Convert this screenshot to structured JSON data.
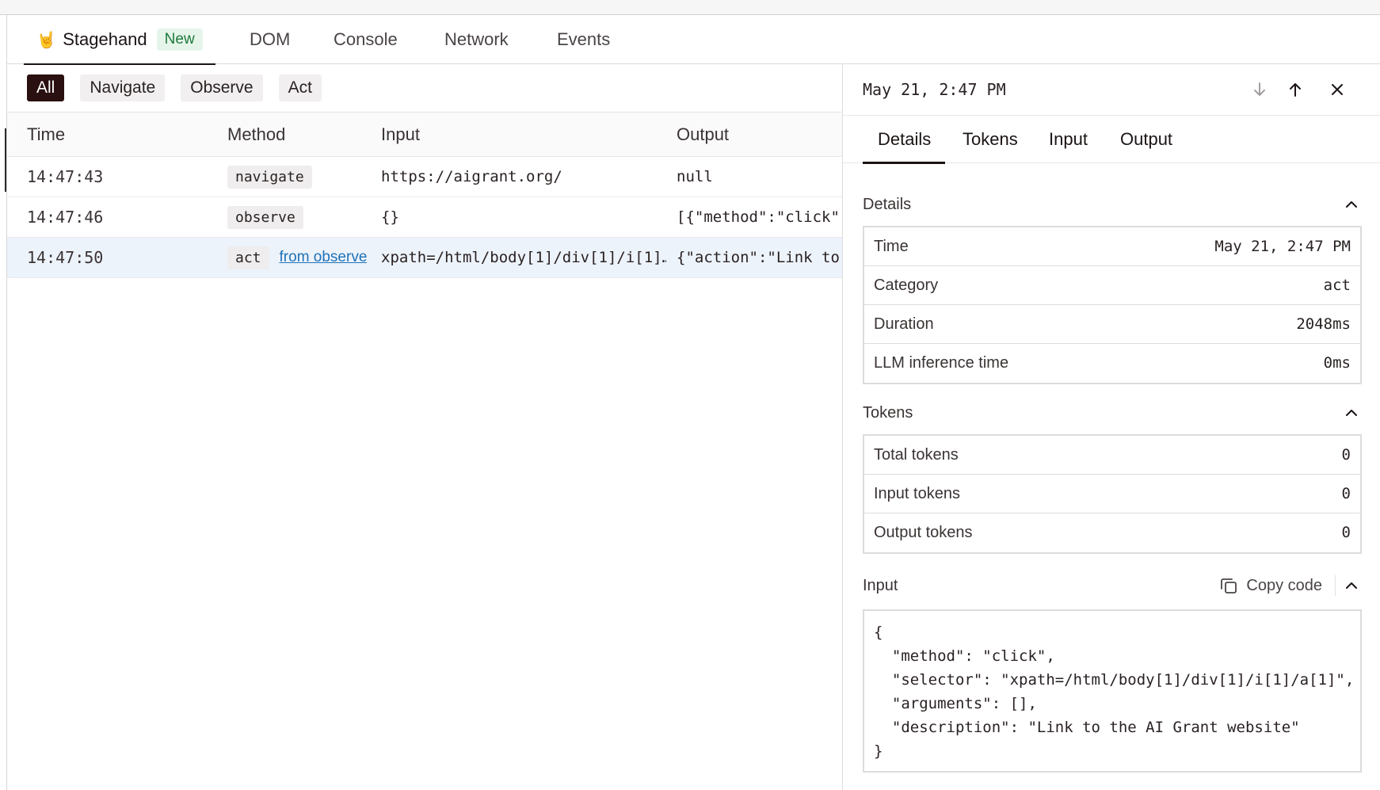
{
  "top_tabs": [
    {
      "label": "Stagehand",
      "badge": "New",
      "icon": "rock-hand-icon"
    },
    {
      "label": "DOM"
    },
    {
      "label": "Console"
    },
    {
      "label": "Network"
    },
    {
      "label": "Events"
    }
  ],
  "filters": [
    "All",
    "Navigate",
    "Observe",
    "Act"
  ],
  "table": {
    "headers": [
      "Time",
      "Method",
      "Input",
      "Output"
    ],
    "rows": [
      {
        "time": "14:47:43",
        "method": "navigate",
        "link": "",
        "input": "https://aigrant.org/",
        "output": "null"
      },
      {
        "time": "14:47:46",
        "method": "observe",
        "link": "",
        "input": "{}",
        "output": "[{\"method\":\"click\","
      },
      {
        "time": "14:47:50",
        "method": "act",
        "link": "from observe",
        "input": "xpath=/html/body[1]/div[1]/i[1]…",
        "output": "{\"action\":\"Link to"
      }
    ]
  },
  "detail": {
    "timestamp": "May 21, 2:47 PM",
    "tabs": [
      "Details",
      "Tokens",
      "Input",
      "Output"
    ],
    "details_title": "Details",
    "details": [
      {
        "key": "Time",
        "value": "May 21, 2:47 PM"
      },
      {
        "key": "Category",
        "value": "act"
      },
      {
        "key": "Duration",
        "value": "2048ms"
      },
      {
        "key": "LLM inference time",
        "value": "0ms"
      }
    ],
    "tokens_title": "Tokens",
    "tokens": [
      {
        "key": "Total tokens",
        "value": "0"
      },
      {
        "key": "Input tokens",
        "value": "0"
      },
      {
        "key": "Output tokens",
        "value": "0"
      }
    ],
    "input_title": "Input",
    "copy_label": "Copy code",
    "code_lines": [
      "{",
      "  \"method\": \"click\",",
      "  \"selector\": \"xpath=/html/body[1]/div[1]/i[1]/a[1]\",",
      "  \"arguments\": [],",
      "  \"description\": \"Link to the AI Grant website\"",
      "}"
    ]
  },
  "colors": {
    "accent": "#2a1010",
    "link": "#1f72b8",
    "selected_row": "#edf3fb",
    "badge_green": "#1f7a3d"
  }
}
